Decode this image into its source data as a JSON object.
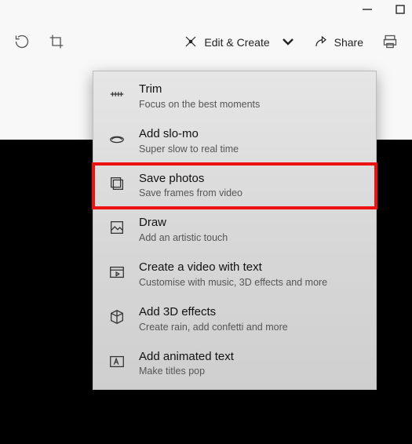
{
  "window": {
    "minimize": "—"
  },
  "toolbar": {
    "edit_create_label": "Edit & Create",
    "share_label": "Share"
  },
  "menu": {
    "items": [
      {
        "title": "Trim",
        "subtitle": "Focus on the best moments",
        "highlight": false
      },
      {
        "title": "Add slo-mo",
        "subtitle": "Super slow to real time",
        "highlight": false
      },
      {
        "title": "Save photos",
        "subtitle": "Save frames from video",
        "highlight": true
      },
      {
        "title": "Draw",
        "subtitle": "Add an artistic touch",
        "highlight": false
      },
      {
        "title": "Create a video with text",
        "subtitle": "Customise with music, 3D effects and more",
        "highlight": false
      },
      {
        "title": "Add 3D effects",
        "subtitle": "Create rain, add confetti and more",
        "highlight": false
      },
      {
        "title": "Add animated text",
        "subtitle": "Make titles pop",
        "highlight": false
      }
    ]
  }
}
